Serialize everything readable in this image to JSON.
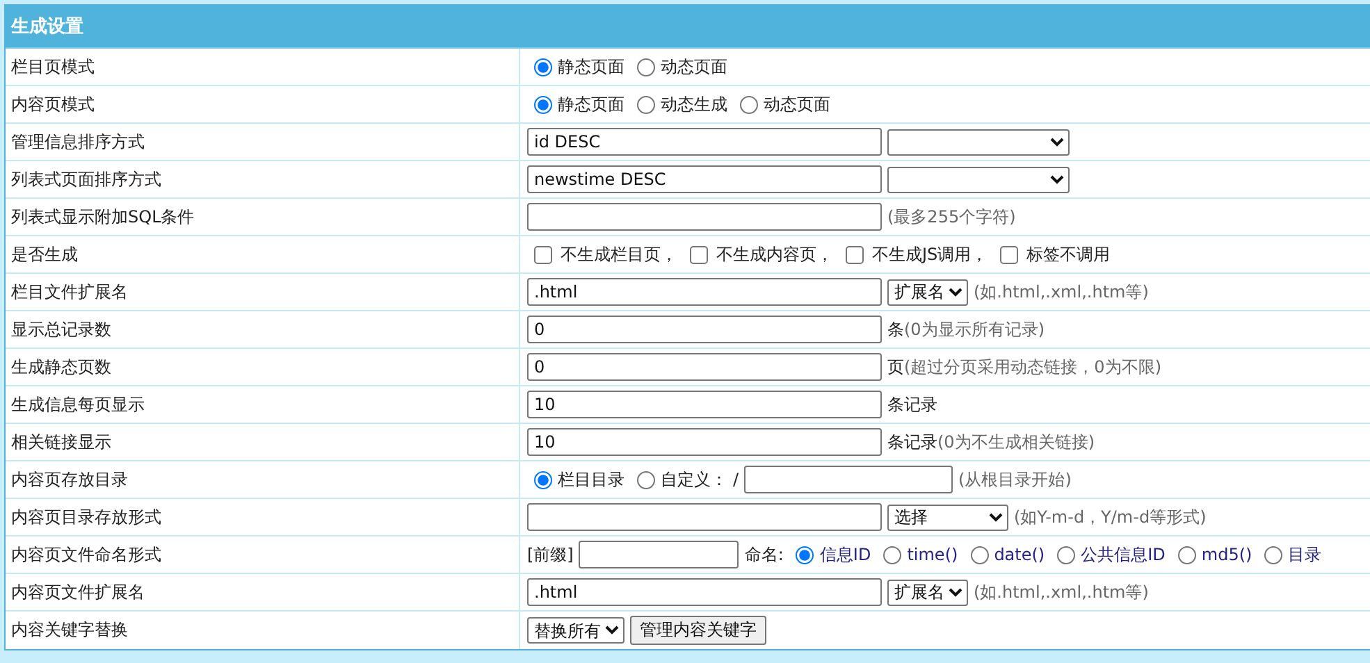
{
  "panel": {
    "title": "生成设置"
  },
  "rows": [
    {
      "label": "栏目页模式",
      "controls": [
        {
          "kind": "radio",
          "label": "静态页面",
          "selected": true
        },
        {
          "kind": "radio",
          "label": "动态页面",
          "selected": false
        }
      ]
    },
    {
      "label": "内容页模式",
      "controls": [
        {
          "kind": "radio",
          "label": "静态页面",
          "selected": true
        },
        {
          "kind": "radio",
          "label": "动态生成",
          "selected": false
        },
        {
          "kind": "radio",
          "label": "动态页面",
          "selected": false
        }
      ]
    },
    {
      "label": "管理信息排序方式",
      "controls": [
        {
          "kind": "input",
          "value": "id DESC"
        },
        {
          "kind": "sort_select"
        }
      ]
    },
    {
      "label": "列表式页面排序方式",
      "controls": [
        {
          "kind": "input",
          "value": "newstime DESC"
        },
        {
          "kind": "sort_select"
        }
      ]
    },
    {
      "label": "列表式显示附加SQL条件",
      "controls": [
        {
          "kind": "input"
        },
        {
          "kind": "note",
          "text": "(最多255个字符)"
        }
      ]
    },
    {
      "label": "是否生成",
      "controls": [
        {
          "kind": "checkbox",
          "label": "不生成栏目页，",
          "checked": false
        },
        {
          "kind": "checkbox",
          "label": "不生成内容页，",
          "checked": false
        },
        {
          "kind": "checkbox",
          "label": "不生成JS调用，",
          "checked": false
        },
        {
          "kind": "checkbox",
          "label": "标签不调用",
          "checked": false
        }
      ]
    },
    {
      "label": "栏目文件扩展名",
      "controls": [
        {
          "kind": "input",
          "value": ".html"
        },
        {
          "kind": "select",
          "value": "扩展名"
        },
        {
          "kind": "note",
          "text": "(如.html,.xml,.htm等)"
        }
      ]
    },
    {
      "label": "显示总记录数",
      "controls": [
        {
          "kind": "input",
          "value": "0"
        },
        {
          "kind": "text",
          "text": "条"
        },
        {
          "kind": "note",
          "text": "(0为显示所有记录)"
        }
      ]
    },
    {
      "label": "生成静态页数",
      "controls": [
        {
          "kind": "input",
          "value": "0"
        },
        {
          "kind": "text",
          "text": "页"
        },
        {
          "kind": "note",
          "text": "(超过分页采用动态链接，0为不限)"
        }
      ]
    },
    {
      "label": "生成信息每页显示",
      "controls": [
        {
          "kind": "input",
          "value": "10"
        },
        {
          "kind": "text",
          "text": "条记录"
        }
      ]
    },
    {
      "label": "相关链接显示",
      "controls": [
        {
          "kind": "input",
          "value": "10"
        },
        {
          "kind": "text",
          "text": "条记录"
        },
        {
          "kind": "note",
          "text": "(0为不生成相关链接)"
        }
      ]
    },
    {
      "label": "内容页存放目录",
      "controls": [
        {
          "kind": "radio",
          "label": "栏目目录",
          "selected": true
        },
        {
          "kind": "radio",
          "label": "自定义：",
          "selected": false
        },
        {
          "kind": "text",
          "text": "/"
        },
        {
          "kind": "path_input"
        },
        {
          "kind": "note",
          "text": "(从根目录开始)"
        }
      ]
    },
    {
      "label": "内容页目录存放形式",
      "controls": [
        {
          "kind": "input"
        },
        {
          "kind": "format_select",
          "value": "选择"
        },
        {
          "kind": "note",
          "text": "(如Y-m-d，Y/m-d等形式)"
        }
      ]
    },
    {
      "label": "内容页文件命名形式",
      "controls": [
        {
          "kind": "text",
          "text": "[前缀]"
        },
        {
          "kind": "prefix_input"
        },
        {
          "kind": "text",
          "text": "命名:"
        },
        {
          "kind": "radio",
          "label": "信息ID",
          "selected": true,
          "link": true
        },
        {
          "kind": "radio",
          "label": "time()",
          "selected": false,
          "link": true
        },
        {
          "kind": "radio",
          "label": "date()",
          "selected": false,
          "link": true
        },
        {
          "kind": "radio",
          "label": "公共信息ID",
          "selected": false,
          "link": true
        },
        {
          "kind": "radio",
          "label": "md5()",
          "selected": false,
          "link": true
        },
        {
          "kind": "radio",
          "label": "目录",
          "selected": false,
          "link": true
        }
      ]
    },
    {
      "label": "内容页文件扩展名",
      "controls": [
        {
          "kind": "input",
          "value": ".html"
        },
        {
          "kind": "select",
          "value": "扩展名"
        },
        {
          "kind": "note",
          "text": "(如.html,.xml,.htm等)"
        }
      ]
    },
    {
      "label": "内容关键字替换",
      "controls": [
        {
          "kind": "select",
          "value": "替换所有"
        },
        {
          "kind": "button",
          "label": "管理内容关键字"
        }
      ]
    }
  ]
}
